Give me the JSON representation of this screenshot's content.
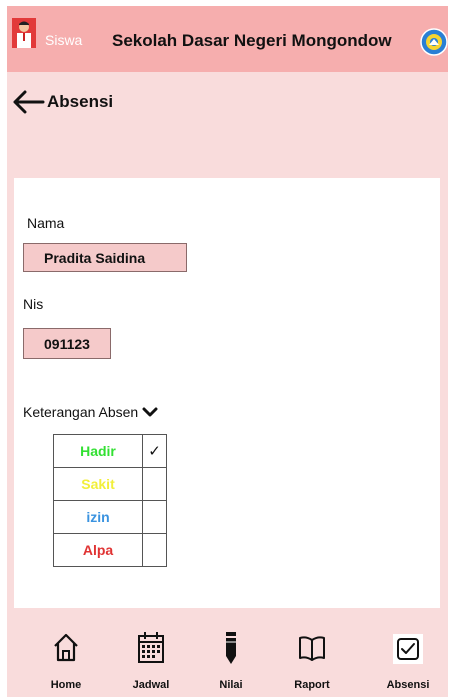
{
  "header": {
    "role": "Siswa",
    "school_name": "Sekolah Dasar Negeri Mongondow",
    "bg_color": "#f6aeae"
  },
  "page": {
    "title": "Absensi"
  },
  "form": {
    "name_label": "Nama",
    "name_value": "Pradita Saidina",
    "nis_label": "Nis",
    "nis_value": "091123",
    "keterangan_label": "Keterangan Absen"
  },
  "attendance_options": [
    {
      "label": "Hadir",
      "color": "#33e033",
      "checked": true,
      "mark": "✓"
    },
    {
      "label": "Sakit",
      "color": "#f2ef3a",
      "checked": false,
      "mark": ""
    },
    {
      "label": "izin",
      "color": "#3a93e0",
      "checked": false,
      "mark": ""
    },
    {
      "label": "Alpa",
      "color": "#e03333",
      "checked": false,
      "mark": ""
    }
  ],
  "nav": [
    {
      "label": "Home",
      "icon": "home-icon"
    },
    {
      "label": "Jadwal",
      "icon": "calendar-icon"
    },
    {
      "label": "Nilai",
      "icon": "pencil-icon"
    },
    {
      "label": "Raport",
      "icon": "book-icon"
    },
    {
      "label": "Absensi",
      "icon": "checkbox-icon",
      "active": true
    }
  ]
}
